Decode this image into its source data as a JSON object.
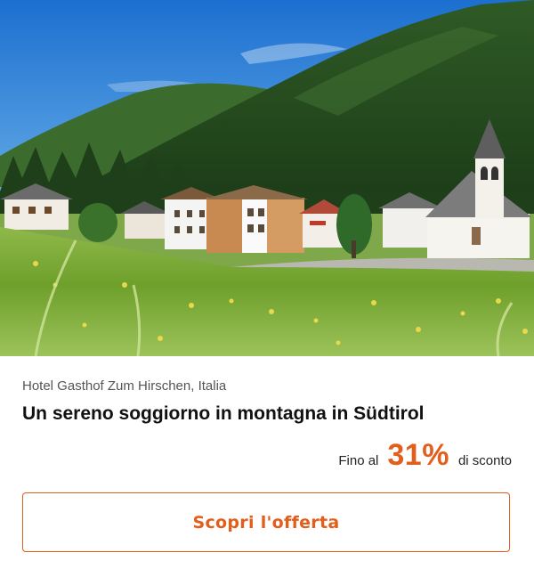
{
  "offer": {
    "location": "Hotel Gasthof Zum Hirschen, Italia",
    "title": "Un sereno soggiorno in montagna in Südtirol",
    "discount_prefix": "Fino al",
    "discount_value": "31%",
    "discount_suffix": "di sconto",
    "cta_label": "Scopri l'offerta"
  },
  "hero": {
    "subject": "mountain village with hotel, church and meadow"
  },
  "colors": {
    "accent": "#e35d1b",
    "sky": "#1f7fd6",
    "forest": "#1f4a1f",
    "meadow": "#6fa12a"
  }
}
